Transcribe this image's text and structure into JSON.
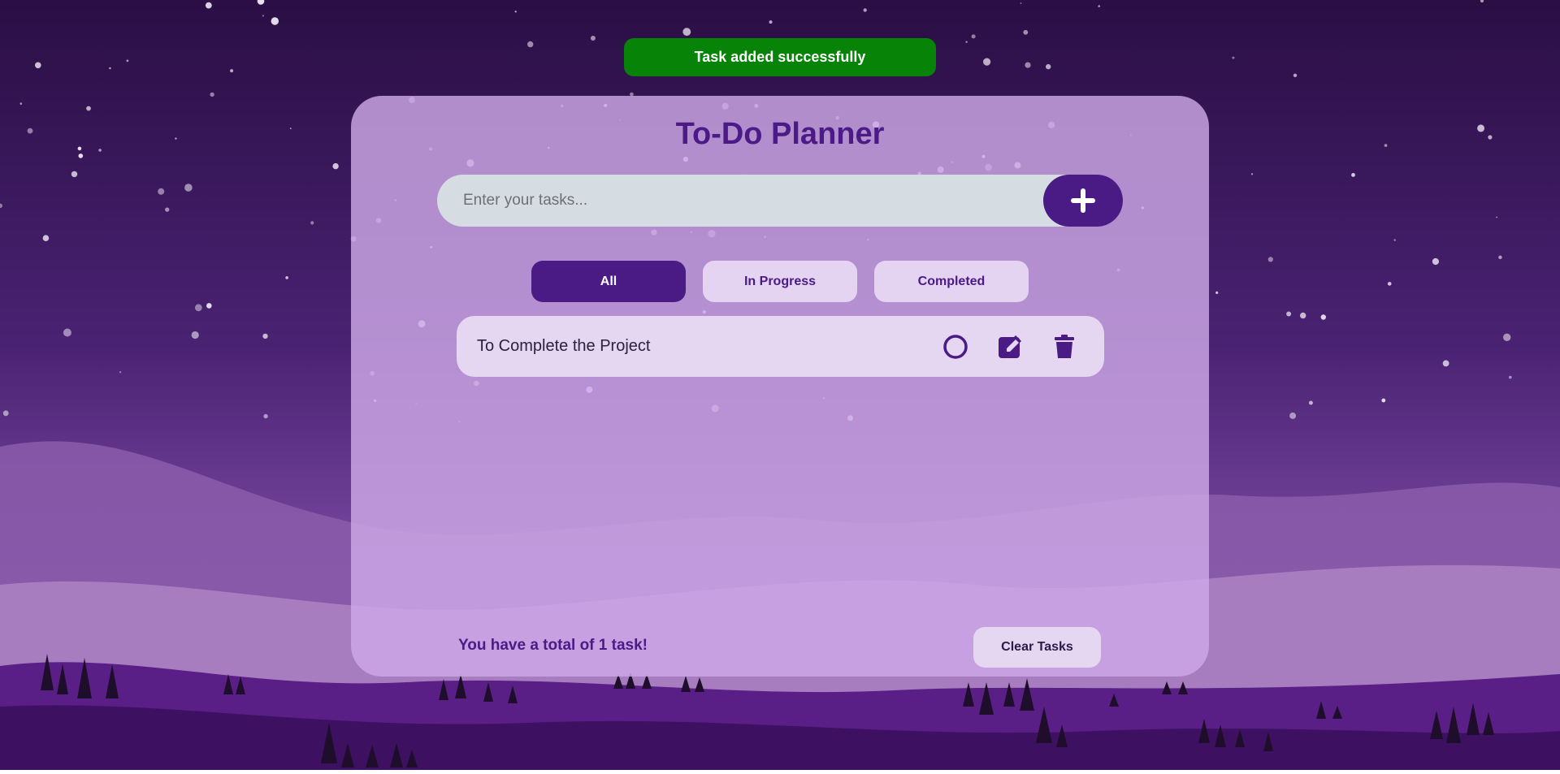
{
  "toast": {
    "message": "Task added successfully"
  },
  "app": {
    "title": "To-Do Planner"
  },
  "input": {
    "placeholder": "Enter your tasks...",
    "value": ""
  },
  "filters": [
    {
      "label": "All",
      "active": true
    },
    {
      "label": "In Progress",
      "active": false
    },
    {
      "label": "Completed",
      "active": false
    }
  ],
  "tasks": [
    {
      "text": "To Complete the Project",
      "completed": false
    }
  ],
  "footer": {
    "summary": "You have a total of 1 task!",
    "clear_label": "Clear Tasks"
  },
  "colors": {
    "accent": "#4a1b84",
    "toast_success": "#078407",
    "panel": "#cda8e6",
    "sky_top": "#2b0f45",
    "sky_bottom": "#7a4aa2"
  },
  "icons": {
    "add": "plus-icon",
    "toggle": "circle-icon",
    "edit": "edit-icon",
    "delete": "trash-icon"
  }
}
